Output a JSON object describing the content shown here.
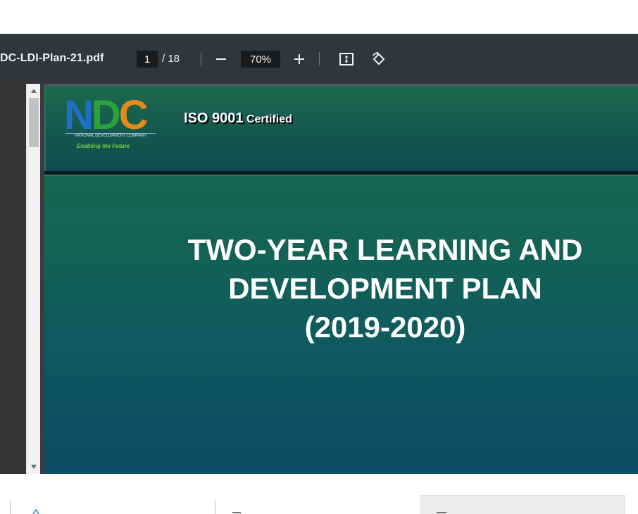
{
  "toolbar": {
    "filename": "DC-LDI-Plan-21.pdf",
    "page_current": "1",
    "page_total": "/ 18",
    "zoom": "70%",
    "icons": {
      "zoom_out": "minus-icon",
      "zoom_in": "plus-icon",
      "fit": "fit-page-icon",
      "rotate": "rotate-icon"
    }
  },
  "pdf_page": {
    "logo": {
      "letters_n": "N",
      "letters_d": "D",
      "letters_c": "C",
      "subtitle": "NATIONAL DEVELOPMENT COMPANY",
      "tagline": "Enabling the Future"
    },
    "iso_main": "ISO 9001",
    "iso_sub": "Certified",
    "title_line1": "TWO-YEAR LEARNING AND",
    "title_line2": "DEVELOPMENT PLAN",
    "title_line3": "(2019-2020)"
  },
  "colors": {
    "toolbar_bg": "#323639",
    "viewer_bg": "#525659",
    "page_green": "#17664e",
    "page_blue": "#0d4a63",
    "logo_blue": "#1f6fc7",
    "logo_green": "#2aa33f",
    "logo_orange": "#e38a1a"
  }
}
